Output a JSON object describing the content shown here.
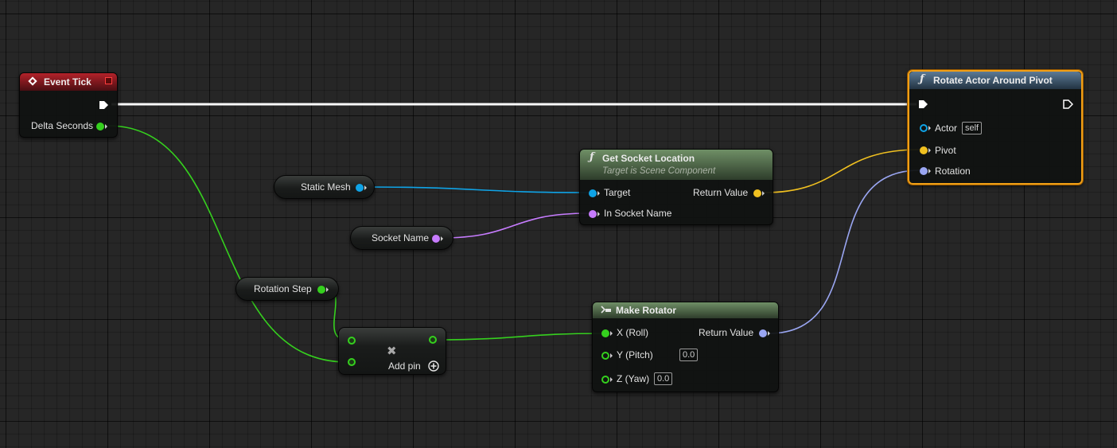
{
  "colors": {
    "exec": "#ffffff",
    "float": "#35d01e",
    "object": "#0fa3e6",
    "vector": "#f0c020",
    "name": "#c77cff",
    "rotator": "#9aa6f2",
    "selected_outline": "#f19f16"
  },
  "nodes": {
    "event_tick": {
      "title": "Event Tick",
      "delta_seconds": "Delta Seconds"
    },
    "rotate_actor": {
      "title": "Rotate Actor Around Pivot",
      "actor": "Actor",
      "actor_default": "self",
      "pivot": "Pivot",
      "rotation": "Rotation"
    },
    "get_socket_location": {
      "title": "Get Socket Location",
      "subtitle": "Target is Scene Component",
      "target": "Target",
      "in_socket_name": "In Socket Name",
      "return_value": "Return Value"
    },
    "static_mesh": {
      "label": "Static Mesh"
    },
    "socket_name": {
      "label": "Socket Name"
    },
    "rotation_step": {
      "label": "Rotation Step"
    },
    "multiply": {
      "add_pin": "Add pin",
      "operator_glyph": "✖"
    },
    "make_rotator": {
      "title": "Make Rotator",
      "x": "X (Roll)",
      "y": "Y (Pitch)",
      "y_default": "0.0",
      "z": "Z (Yaw)",
      "z_default": "0.0",
      "return_value": "Return Value"
    }
  }
}
